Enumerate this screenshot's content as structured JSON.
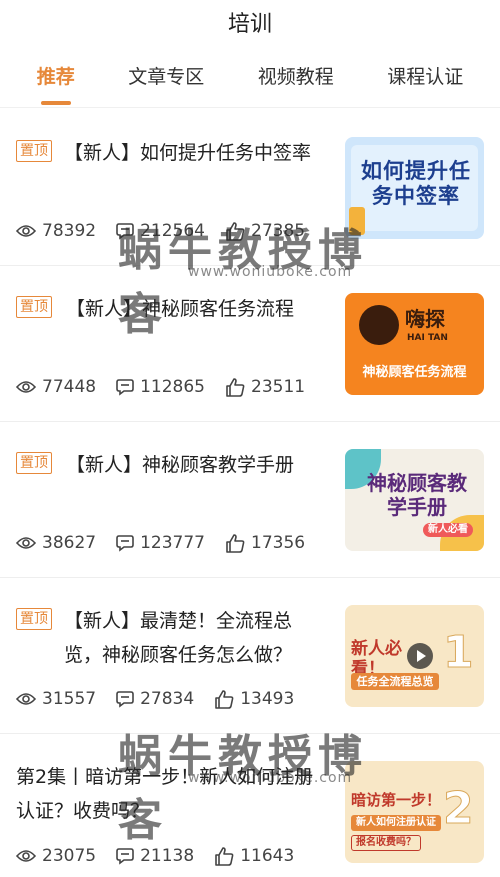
{
  "header": {
    "title": "培训"
  },
  "tabs": [
    {
      "label": "推荐",
      "active": true
    },
    {
      "label": "文章专区",
      "active": false
    },
    {
      "label": "视频教程",
      "active": false
    },
    {
      "label": "课程认证",
      "active": false
    }
  ],
  "articles": [
    {
      "pinned": true,
      "pin_label": "置顶",
      "title": "【新人】如何提升任务中签率",
      "views": "78392",
      "comments": "212564",
      "likes": "27385",
      "thumb_text": "如何提升任务中签率"
    },
    {
      "pinned": true,
      "pin_label": "置顶",
      "title": "【新人】神秘顾客任务流程",
      "views": "77448",
      "comments": "112865",
      "likes": "23511",
      "thumb_brand": "嗨探",
      "thumb_brand_en": "HAI TAN",
      "thumb_text": "神秘顾客任务流程"
    },
    {
      "pinned": true,
      "pin_label": "置顶",
      "title": "【新人】神秘顾客教学手册",
      "views": "38627",
      "comments": "123777",
      "likes": "17356",
      "thumb_text": "神秘顾客教学手册",
      "thumb_badge": "新人必看"
    },
    {
      "pinned": true,
      "pin_label": "置顶",
      "title": "【新人】最清楚！全流程总览，神秘顾客任务怎么做？",
      "views": "31557",
      "comments": "27834",
      "likes": "13493",
      "thumb_text": "新人必看！",
      "thumb_sub": "任务全流程总览",
      "thumb_num": "1"
    },
    {
      "pinned": false,
      "title": "第2集丨暗访第一步！新人如何注册认证？收费吗？",
      "views": "23075",
      "comments": "21138",
      "likes": "11643",
      "thumb_text": "暗访第一步！",
      "thumb_sub": "新人如何注册认证",
      "thumb_sub2": "报名收费吗？",
      "thumb_num": "2"
    }
  ],
  "watermark": {
    "text": "蜗牛教授博客",
    "url": "www.woniuboke.com"
  },
  "colors": {
    "accent": "#e6883a",
    "text": "#222222",
    "divider": "#eeeeee"
  }
}
